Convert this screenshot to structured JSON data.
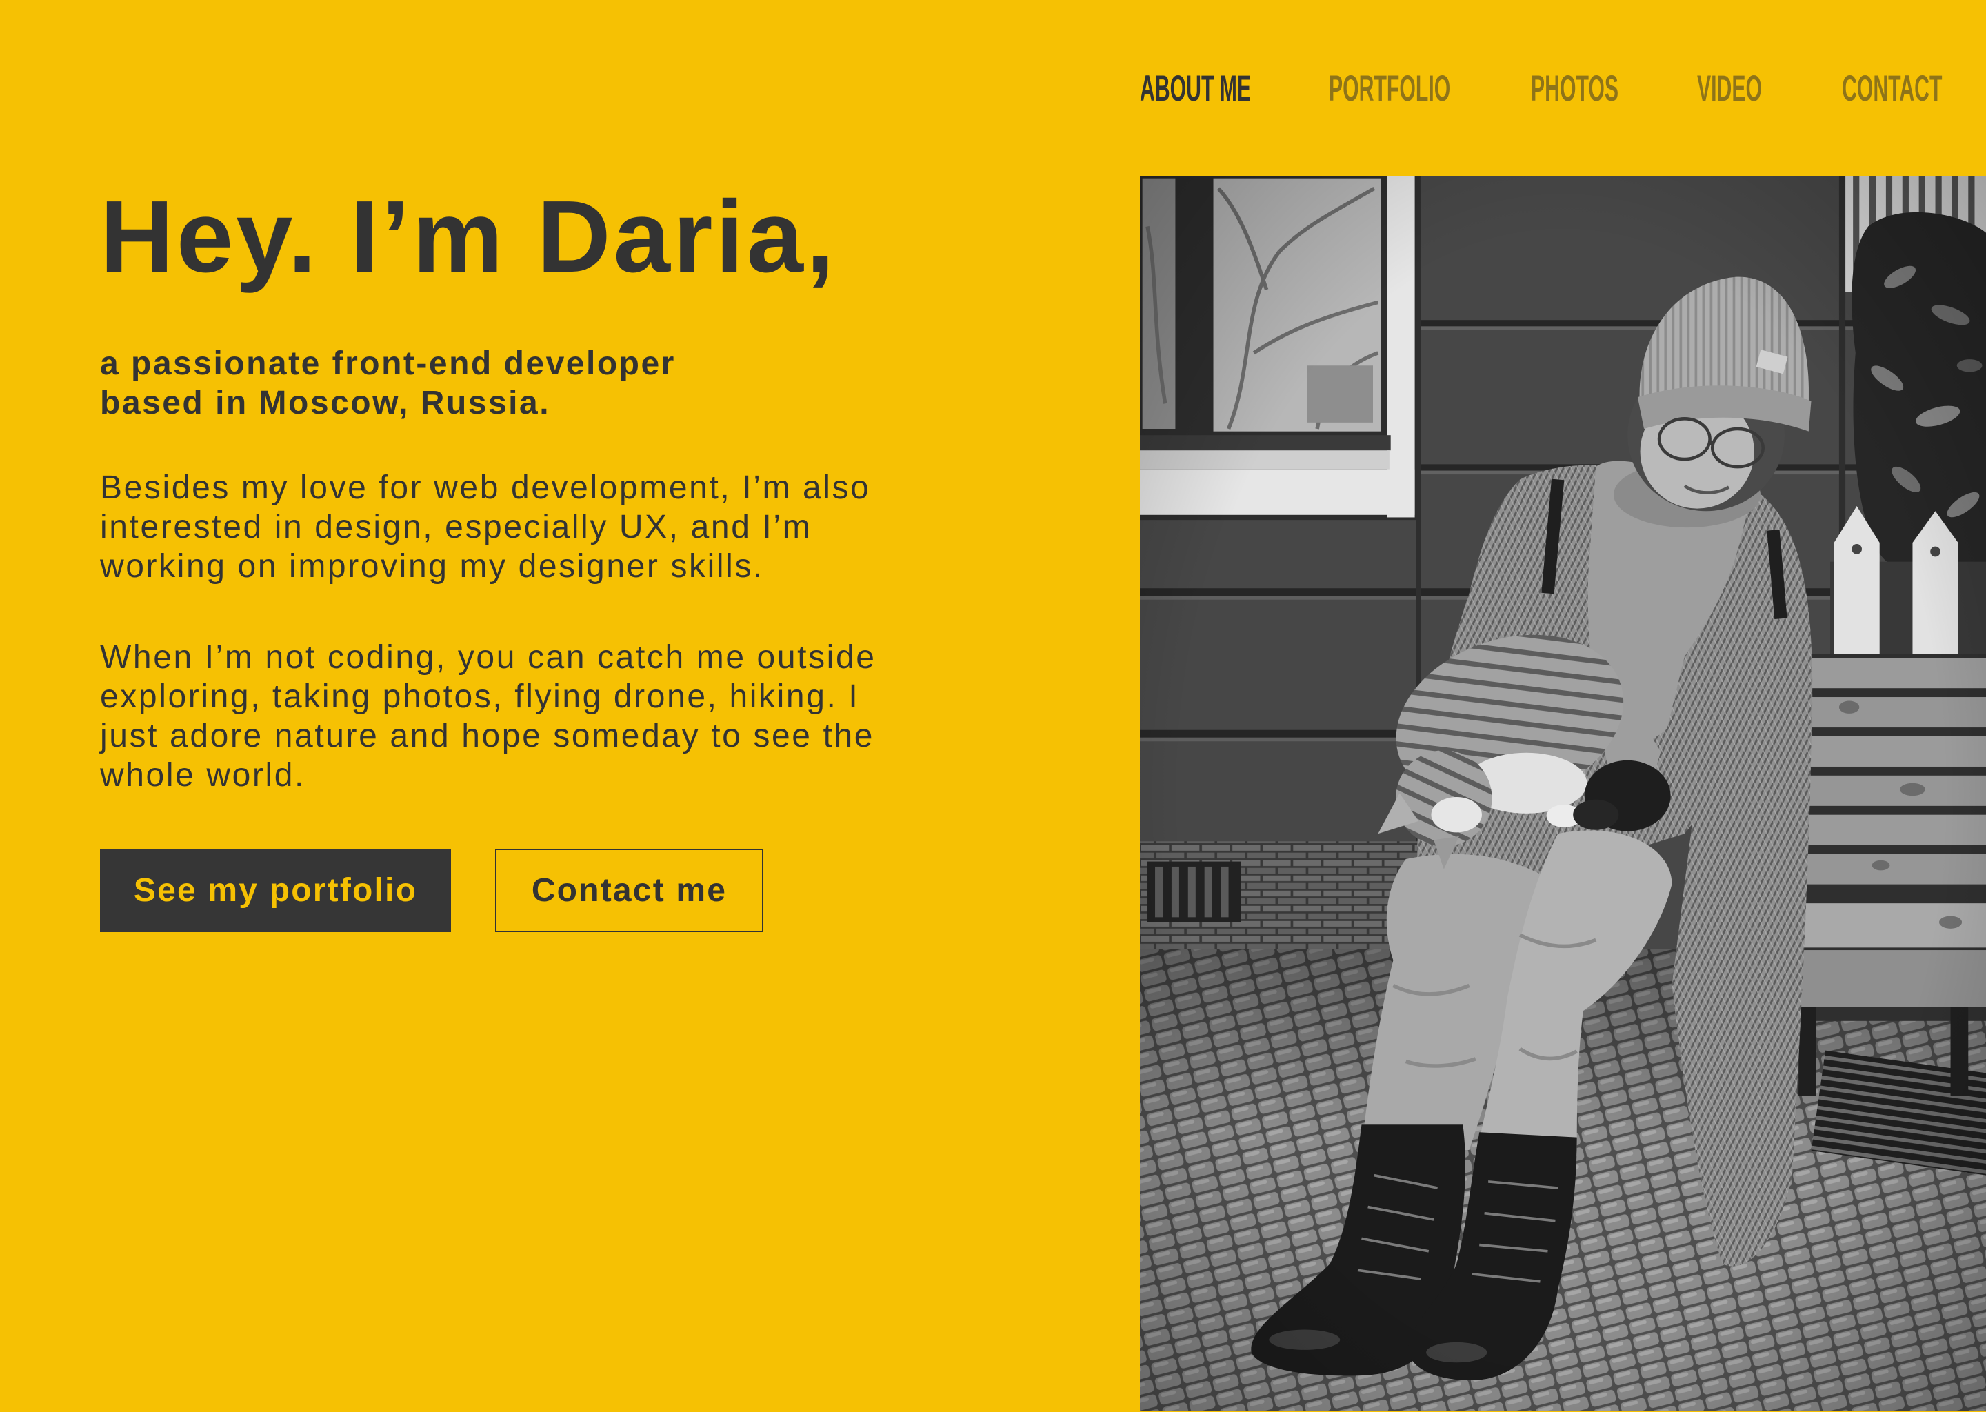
{
  "theme": {
    "background": "#F6C103",
    "text": "#333333",
    "nav_inactive": "#8E7419"
  },
  "nav": {
    "items": [
      {
        "label": "ABOUT ME",
        "active": true
      },
      {
        "label": "PORTFOLIO",
        "active": false
      },
      {
        "label": "PHOTOS",
        "active": false
      },
      {
        "label": "VIDEO",
        "active": false
      },
      {
        "label": "CONTACT",
        "active": false
      }
    ]
  },
  "hero": {
    "title": "Hey. I’m Daria,",
    "subtitle_lines": [
      "a passionate front-end developer",
      "based in Moscow, Russia."
    ],
    "paragraphs": [
      {
        "lines": [
          "Besides my love for web development, I’m also",
          "interested in design, especially UX, and I’m",
          "working on improving my designer skills."
        ]
      },
      {
        "lines": [
          "When I’m not coding, you can catch me outside",
          "exploring, taking photos, flying drone, hiking. I",
          "just adore nature and hope someday to see the",
          "whole world."
        ]
      }
    ]
  },
  "buttons": {
    "primary": "See my portfolio",
    "secondary": "Contact me"
  }
}
